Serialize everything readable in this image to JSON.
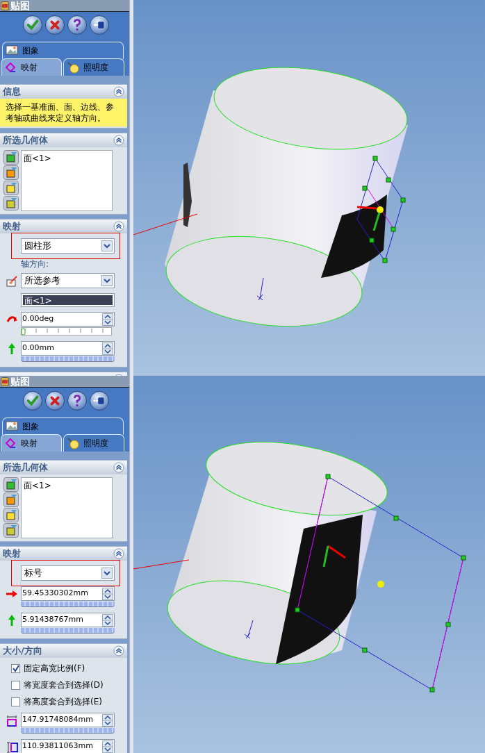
{
  "panels": [
    {
      "title": "贴图",
      "buttons": [
        {
          "kind": "ok"
        },
        {
          "kind": "cancel"
        },
        {
          "kind": "help"
        },
        {
          "kind": "pin"
        }
      ],
      "tabs": [
        {
          "label": "图象",
          "kind": "image",
          "selected": false
        },
        {
          "label": "映射",
          "kind": "mapping",
          "selected": true
        },
        {
          "label": "照明度",
          "kind": "lighting",
          "selected": false
        }
      ],
      "sections": [
        {
          "title": "信息",
          "kind": "message",
          "text": "选择一基准面、面、边线、参考轴或曲线来定义轴方向。"
        },
        {
          "title": "所选几何体",
          "kind": "selection",
          "items": [
            "面<1>"
          ]
        },
        {
          "title": "映射",
          "kind": "controls",
          "rows": [
            {
              "kind": "dropdown",
              "value": "圆柱形",
              "highlighted": true
            },
            {
              "kind": "label",
              "text": "轴方向:"
            },
            {
              "kind": "axis-dropdown",
              "value": "所选参考",
              "highlighted": false
            },
            {
              "kind": "selected",
              "value": "面<1>"
            },
            {
              "kind": "angle",
              "value": "0.00deg",
              "level": 0
            },
            {
              "kind": "offset-up",
              "value": "0.00mm"
            }
          ]
        },
        {
          "kind": "collapsed"
        }
      ]
    },
    {
      "title": "贴图",
      "buttons": [
        {
          "kind": "ok"
        },
        {
          "kind": "cancel"
        },
        {
          "kind": "help"
        },
        {
          "kind": "pin"
        }
      ],
      "tabs": [
        {
          "label": "图象",
          "kind": "image",
          "selected": false
        },
        {
          "label": "映射",
          "kind": "mapping",
          "selected": true
        },
        {
          "label": "照明度",
          "kind": "lighting",
          "selected": false
        }
      ],
      "sections": [
        {
          "title": "所选几何体",
          "kind": "selection",
          "items": [
            "面<1>"
          ]
        },
        {
          "title": "映射",
          "kind": "controls",
          "rows": [
            {
              "kind": "dropdown",
              "value": "标号",
              "highlighted": true
            },
            {
              "kind": "offset-right",
              "value": "59.45330302mm"
            },
            {
              "kind": "offset-up",
              "value": "5.91438767mm"
            }
          ]
        },
        {
          "title": "大小/方向",
          "kind": "controls",
          "rows": [
            {
              "kind": "checkbox",
              "label": "固定高宽比例(F)",
              "checked": true
            },
            {
              "kind": "checkbox",
              "label": "将宽度套合到选择(D)",
              "checked": false
            },
            {
              "kind": "checkbox",
              "label": "将高度套合到选择(E)",
              "checked": false
            },
            {
              "kind": "width",
              "value": "147.91748084mm"
            },
            {
              "kind": "height",
              "value": "110.93811063mm"
            }
          ]
        }
      ]
    }
  ]
}
